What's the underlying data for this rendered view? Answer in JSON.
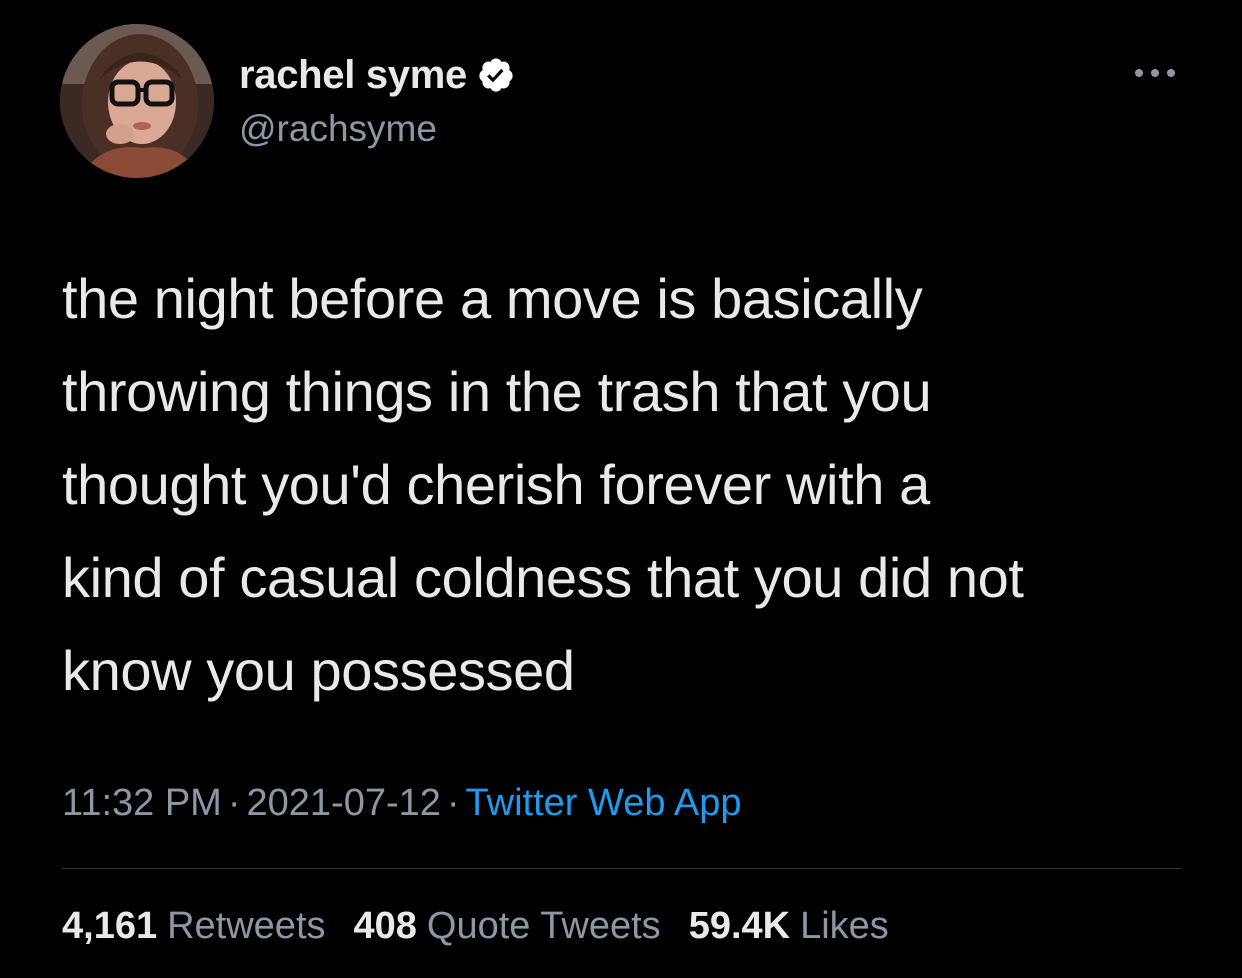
{
  "author": {
    "display_name": "rachel syme",
    "handle": "@rachsyme",
    "verified": true
  },
  "tweet": {
    "text": "the night before a move is basically\nthrowing things in the trash that you\nthought you'd cherish forever with a\nkind of casual coldness that you did not\nknow you possessed"
  },
  "meta": {
    "time": "11:32 PM",
    "date": "2021-07-12",
    "separator": "·",
    "source": "Twitter Web App"
  },
  "stats": {
    "retweets_count": "4,161",
    "retweets_label": "Retweets",
    "quotes_count": "408",
    "quotes_label": "Quote Tweets",
    "likes_count": "59.4K",
    "likes_label": "Likes"
  },
  "icons": {
    "verified": "verified-badge-icon",
    "more": "more-options-icon"
  },
  "colors": {
    "background": "#000000",
    "primary_text": "#e7e9ea",
    "secondary_text": "#8b98a5",
    "link": "#1d9bf0",
    "divider": "#2f3336"
  }
}
